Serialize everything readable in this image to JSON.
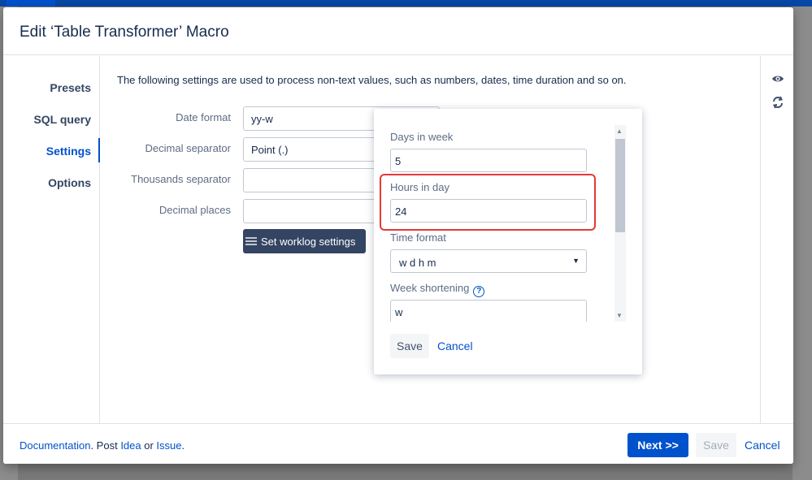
{
  "dialog": {
    "title": "Edit ‘Table Transformer’ Macro"
  },
  "nav": {
    "items": [
      {
        "label": "Presets"
      },
      {
        "label": "SQL query"
      },
      {
        "label": "Settings"
      },
      {
        "label": "Options"
      }
    ],
    "active": "Settings"
  },
  "settings": {
    "description": "The following settings are used to process non-text values, such as numbers, dates, time duration and so on.",
    "date_format": {
      "label": "Date format",
      "value": "yy-w"
    },
    "decimal_separator": {
      "label": "Decimal separator",
      "value": "Point (.)"
    },
    "thousands_separator": {
      "label": "Thousands separator",
      "value": ""
    },
    "decimal_places": {
      "label": "Decimal places",
      "value": ""
    },
    "worklog_button": "Set worklog settings"
  },
  "worklog_popup": {
    "days_in_week": {
      "label": "Days in week",
      "value": "5"
    },
    "hours_in_day": {
      "label": "Hours in day",
      "value": "24"
    },
    "time_format": {
      "label": "Time format",
      "value": "w d h m"
    },
    "week_shortening": {
      "label": "Week shortening",
      "value": "w",
      "help_icon": "?"
    },
    "save": "Save",
    "cancel": "Cancel"
  },
  "footer": {
    "documentation": "Documentation",
    "post_text": ". Post ",
    "idea": "Idea",
    "or_text": " or ",
    "issue": "Issue",
    "dot": ".",
    "next": "Next >>",
    "save": "Save",
    "cancel": "Cancel"
  },
  "side_icons": [
    "eye-icon",
    "refresh-icon"
  ],
  "colors": {
    "primary": "#0052cc",
    "dark_button": "#344563",
    "highlight": "#e53935"
  }
}
